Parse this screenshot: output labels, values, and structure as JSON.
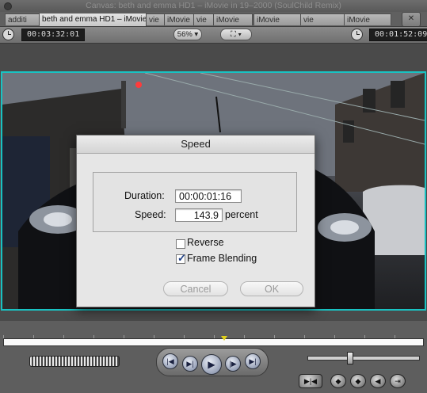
{
  "window": {
    "title": "Canvas: beth and emma HD1 – iMovie in 19–2000 (SoulChild Remix)"
  },
  "tabs": [
    {
      "label": "additi"
    },
    {
      "label": "beth and emma HD1 – iMovie"
    },
    {
      "label": "vie"
    },
    {
      "label": "iMovie"
    },
    {
      "label": "vie"
    },
    {
      "label": "iMovie"
    },
    {
      "label": "iMovie"
    },
    {
      "label": "vie"
    },
    {
      "label": "iMovie"
    }
  ],
  "toolbar": {
    "current_timecode": "00:03:32:01",
    "zoom": "56%",
    "view_options_icon": "fit-icon",
    "duration_timecode": "00:01:52:09"
  },
  "dialog": {
    "title": "Speed",
    "duration_label": "Duration:",
    "duration_value": "00:00:01:16",
    "speed_label": "Speed:",
    "speed_value": "143.9",
    "speed_unit": "percent",
    "reverse_label": "Reverse",
    "reverse_checked": false,
    "frame_blending_label": "Frame Blending",
    "frame_blending_checked": true,
    "cancel_label": "Cancel",
    "ok_label": "OK"
  },
  "transport": {
    "prev_edit": "|◀",
    "play_in_out": "▶|",
    "play": "▶",
    "play_around": "|▶",
    "next_edit": "▶|"
  },
  "colors": {
    "canvas_border": "#19c2c2",
    "playhead": "#e0d01a"
  }
}
